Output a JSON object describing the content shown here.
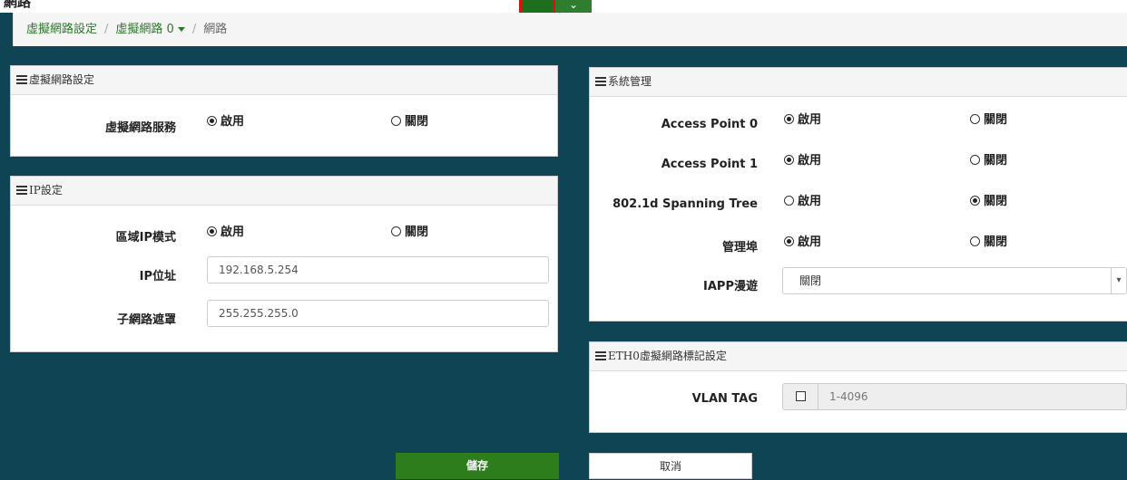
{
  "top": {
    "caption": "網路",
    "button_icon": "chevron-down-icon"
  },
  "breadcrumb": {
    "item1": "虛擬網路設定",
    "sep": "/",
    "item2": "虛擬網路 0",
    "item3": "網路"
  },
  "vlan_panel": {
    "title": "虛擬網路設定",
    "service_label": "虛擬網路服務",
    "enable": "啟用",
    "disable": "關閉",
    "selected": "enable"
  },
  "ip_panel": {
    "title": "IP設定",
    "mode_label": "區域IP模式",
    "enable": "啟用",
    "disable": "關閉",
    "mode_selected": "enable",
    "ip_label": "IP位址",
    "ip_value": "192.168.5.254",
    "mask_label": "子網路遮罩",
    "mask_value": "255.255.255.0"
  },
  "sys_panel": {
    "title": "系統管理",
    "rows": [
      {
        "label": "Access Point 0",
        "enable": "啟用",
        "disable": "關閉",
        "selected": "enable"
      },
      {
        "label": "Access Point 1",
        "enable": "啟用",
        "disable": "關閉",
        "selected": "enable"
      },
      {
        "label": "802.1d Spanning Tree",
        "enable": "啟用",
        "disable": "關閉",
        "selected": "disable"
      },
      {
        "label": "管理埠",
        "enable": "啟用",
        "disable": "關閉",
        "selected": "enable"
      }
    ],
    "iapp_label": "IAPP漫遊",
    "iapp_value": "關閉"
  },
  "eth_panel": {
    "title": "ETH0虛擬網路標記設定",
    "vlan_label": "VLAN TAG",
    "vlan_placeholder": "1-4096"
  },
  "buttons": {
    "save": "儲存",
    "cancel": "取消"
  }
}
